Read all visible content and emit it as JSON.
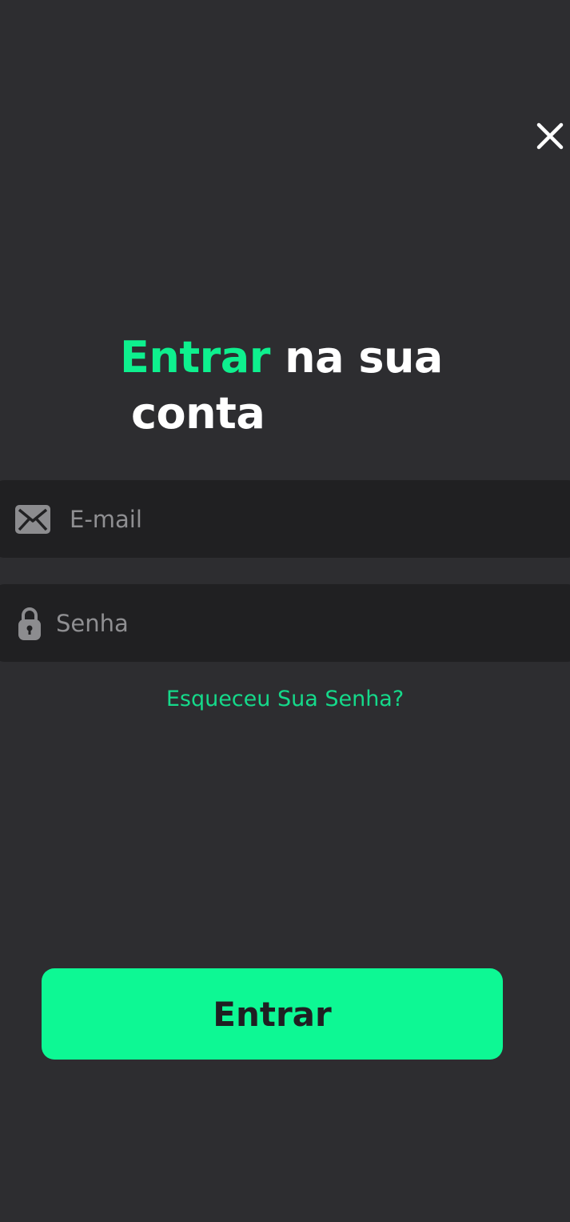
{
  "header": {
    "close_icon": "close-icon"
  },
  "title": {
    "accent_word": "Entrar",
    "line1_rest": " na sua",
    "line2": "conta"
  },
  "form": {
    "email": {
      "icon": "envelope-icon",
      "placeholder": "E-mail",
      "value": ""
    },
    "password": {
      "icon": "lock-icon",
      "placeholder": "Senha",
      "value": ""
    },
    "forgot_link": "Esqueceu Sua Senha?",
    "submit_label": "Entrar"
  },
  "colors": {
    "background": "#2d2d30",
    "field_bg": "#202022",
    "accent": "#0df894",
    "link": "#15d98a",
    "text_primary": "#ffffff",
    "placeholder": "#8f8f92"
  }
}
